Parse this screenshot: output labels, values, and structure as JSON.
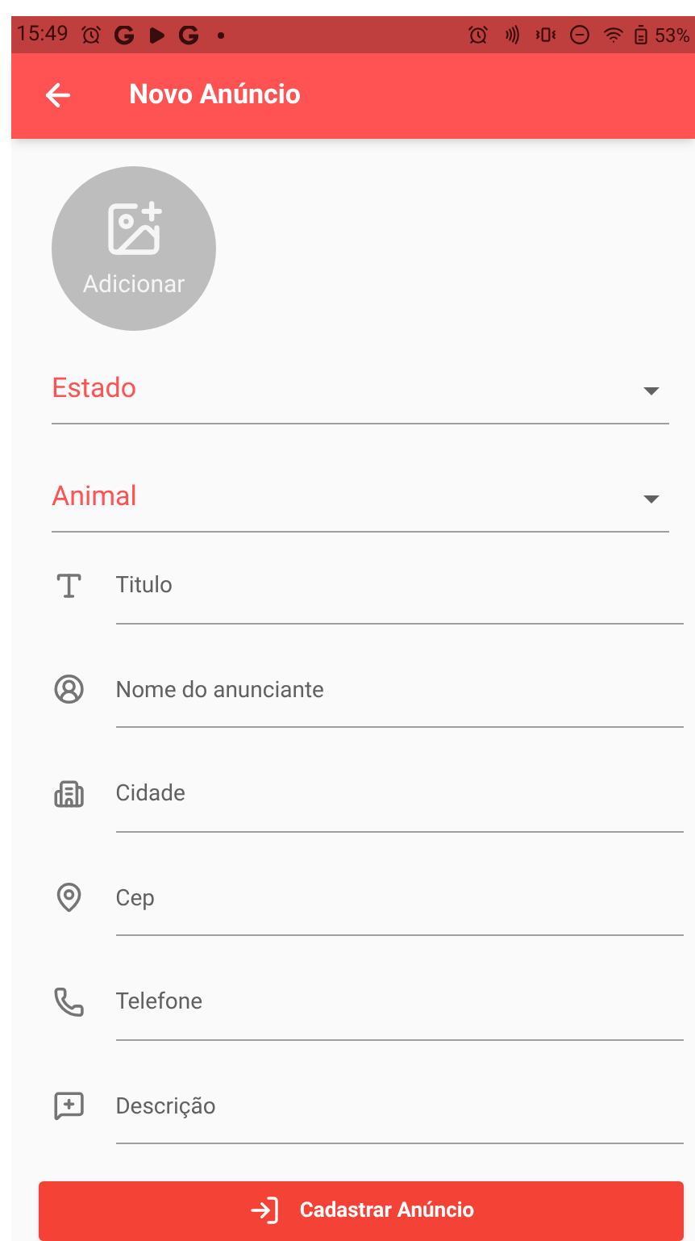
{
  "status_bar": {
    "time": "15:49",
    "battery": "53%"
  },
  "app_bar": {
    "title": "Novo Anúncio"
  },
  "photo_button": {
    "label": "Adicionar"
  },
  "dropdowns": [
    {
      "label": "Estado"
    },
    {
      "label": "Animal"
    }
  ],
  "fields": [
    {
      "placeholder": "Titulo"
    },
    {
      "placeholder": "Nome do anunciante"
    },
    {
      "placeholder": "Cidade"
    },
    {
      "placeholder": "Cep"
    },
    {
      "placeholder": "Telefone"
    },
    {
      "placeholder": "Descrição"
    }
  ],
  "submit_button": {
    "label": "Cadastrar Anúncio"
  }
}
